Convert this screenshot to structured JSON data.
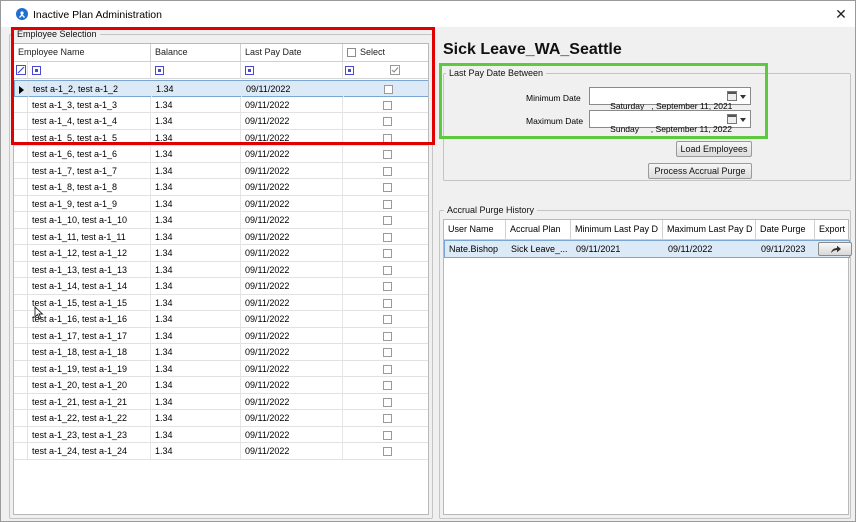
{
  "window": {
    "title": "Inactive Plan Administration",
    "close_glyph": "✕"
  },
  "employee_group": {
    "label": "Employee Selection",
    "columns": [
      "Employee Name",
      "Balance",
      "Last Pay Date",
      "Select"
    ],
    "rows": [
      {
        "name": "test a-1_2, test a-1_2",
        "balance": "1.34",
        "date": "09/11/2022"
      },
      {
        "name": "test a-1_3, test a-1_3",
        "balance": "1.34",
        "date": "09/11/2022"
      },
      {
        "name": "test a-1_4, test a-1_4",
        "balance": "1.34",
        "date": "09/11/2022"
      },
      {
        "name": "test a-1_5, test a-1_5",
        "balance": "1.34",
        "date": "09/11/2022"
      },
      {
        "name": "test a-1_6, test a-1_6",
        "balance": "1.34",
        "date": "09/11/2022"
      },
      {
        "name": "test a-1_7, test a-1_7",
        "balance": "1.34",
        "date": "09/11/2022"
      },
      {
        "name": "test a-1_8, test a-1_8",
        "balance": "1.34",
        "date": "09/11/2022"
      },
      {
        "name": "test a-1_9, test a-1_9",
        "balance": "1.34",
        "date": "09/11/2022"
      },
      {
        "name": "test a-1_10, test a-1_10",
        "balance": "1.34",
        "date": "09/11/2022"
      },
      {
        "name": "test a-1_11, test a-1_11",
        "balance": "1.34",
        "date": "09/11/2022"
      },
      {
        "name": "test a-1_12, test a-1_12",
        "balance": "1.34",
        "date": "09/11/2022"
      },
      {
        "name": "test a-1_13, test a-1_13",
        "balance": "1.34",
        "date": "09/11/2022"
      },
      {
        "name": "test a-1_14, test a-1_14",
        "balance": "1.34",
        "date": "09/11/2022"
      },
      {
        "name": "test a-1_15, test a-1_15",
        "balance": "1.34",
        "date": "09/11/2022"
      },
      {
        "name": "test a-1_16, test a-1_16",
        "balance": "1.34",
        "date": "09/11/2022"
      },
      {
        "name": "test a-1_17, test a-1_17",
        "balance": "1.34",
        "date": "09/11/2022"
      },
      {
        "name": "test a-1_18, test a-1_18",
        "balance": "1.34",
        "date": "09/11/2022"
      },
      {
        "name": "test a-1_19, test a-1_19",
        "balance": "1.34",
        "date": "09/11/2022"
      },
      {
        "name": "test a-1_20, test a-1_20",
        "balance": "1.34",
        "date": "09/11/2022"
      },
      {
        "name": "test a-1_21, test a-1_21",
        "balance": "1.34",
        "date": "09/11/2022"
      },
      {
        "name": "test a-1_22, test a-1_22",
        "balance": "1.34",
        "date": "09/11/2022"
      },
      {
        "name": "test a-1_23, test a-1_23",
        "balance": "1.34",
        "date": "09/11/2022"
      },
      {
        "name": "test a-1_24, test a-1_24",
        "balance": "1.34",
        "date": "09/11/2022"
      }
    ]
  },
  "plan_heading": "Sick Leave_WA_Seattle",
  "date_group": {
    "label": "Last Pay Date Between",
    "min_label": "Minimum Date",
    "min_value": "Saturday   , September 11, 2021",
    "max_label": "Maximum Date",
    "max_value": "Sunday     , September 11, 2022"
  },
  "buttons": {
    "load": "Load Employees",
    "process": "Process Accrual Purge"
  },
  "history_group": {
    "label": "Accrual Purge History",
    "columns": [
      "User Name",
      "Accrual Plan",
      "Minimum Last Pay D",
      "Maximum Last Pay D",
      "Date Purge",
      "Export"
    ],
    "rows": [
      {
        "user": "Nate.Bishop",
        "plan": "Sick Leave_...",
        "min": "09/11/2021",
        "max": "09/11/2022",
        "date": "09/11/2023"
      }
    ]
  },
  "colors": {
    "highlight_red": "#e00000",
    "highlight_green": "#5cc93f",
    "selection": "#dce9f7"
  }
}
